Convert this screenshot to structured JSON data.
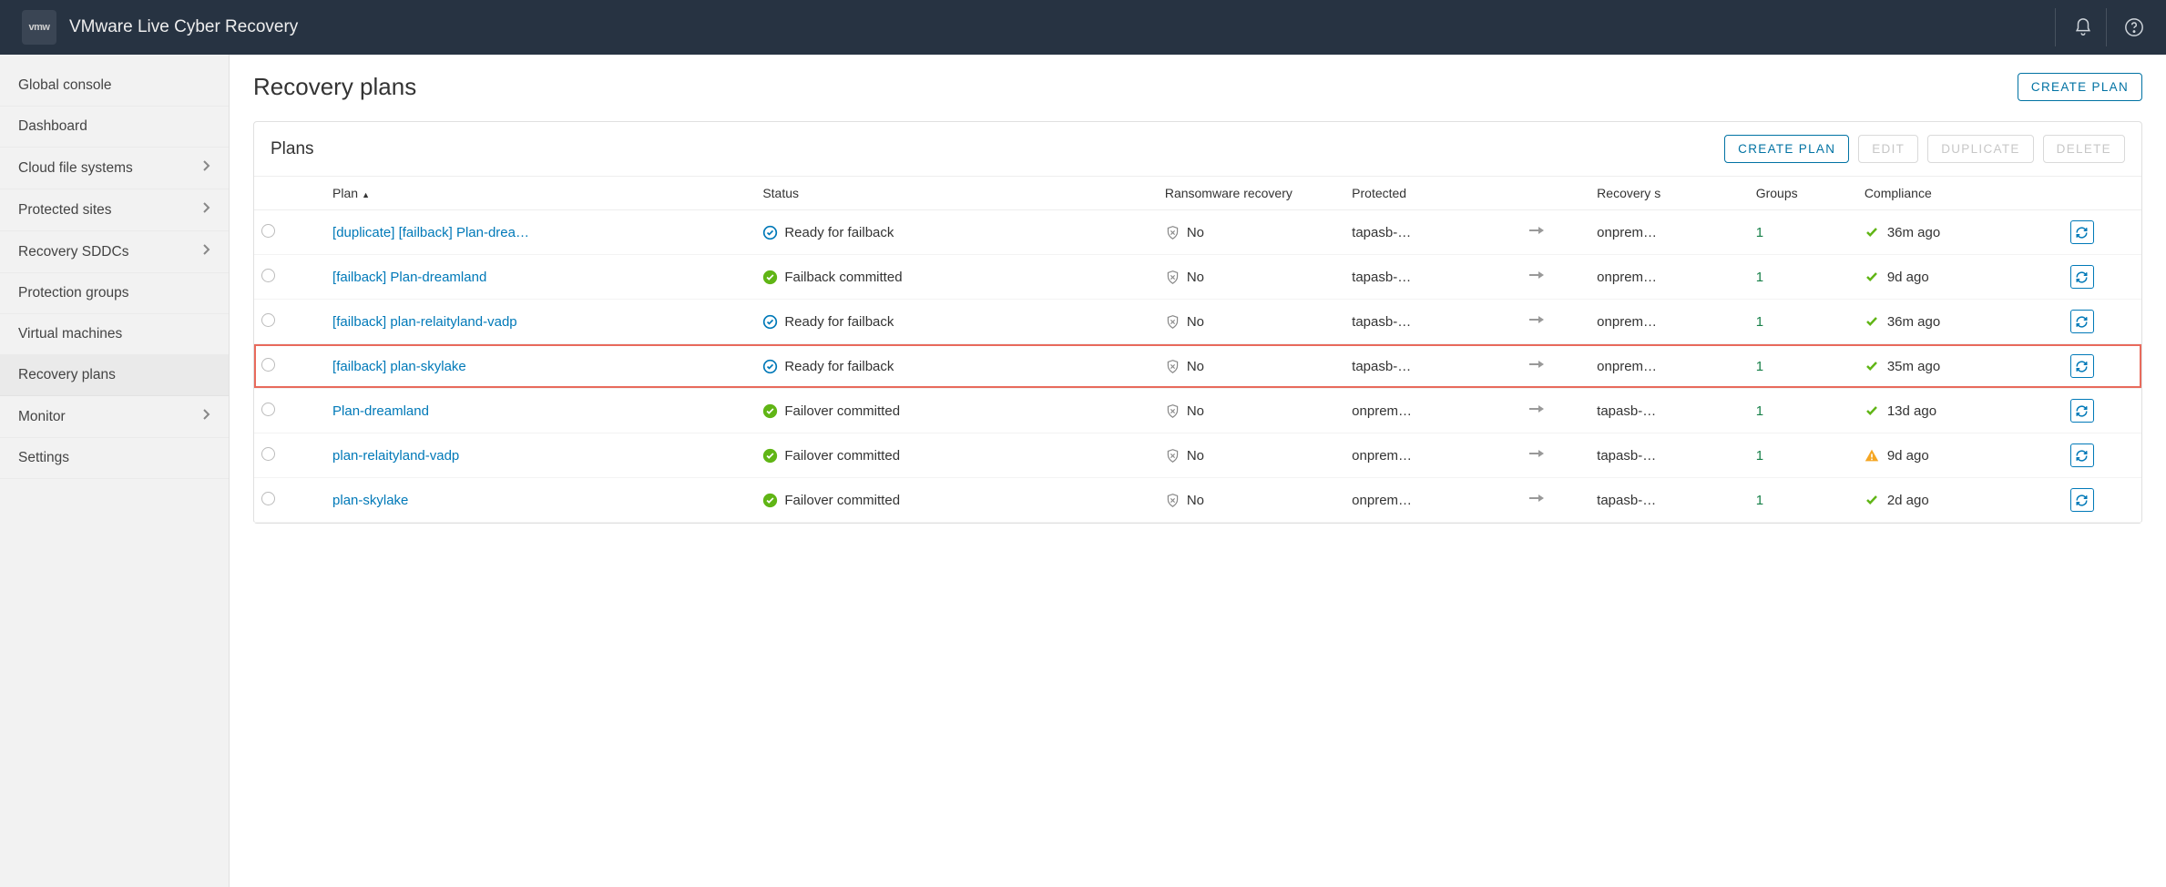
{
  "app": {
    "logo_text": "vmw",
    "title": "VMware Live Cyber Recovery"
  },
  "sidebar": {
    "items": [
      {
        "label": "Global console",
        "chevron": false,
        "active": false
      },
      {
        "label": "Dashboard",
        "chevron": false,
        "active": false
      },
      {
        "label": "Cloud file systems",
        "chevron": true,
        "active": false
      },
      {
        "label": "Protected sites",
        "chevron": true,
        "active": false
      },
      {
        "label": "Recovery SDDCs",
        "chevron": true,
        "active": false
      },
      {
        "label": "Protection groups",
        "chevron": false,
        "active": false
      },
      {
        "label": "Virtual machines",
        "chevron": false,
        "active": false
      },
      {
        "label": "Recovery plans",
        "chevron": false,
        "active": true
      },
      {
        "label": "Monitor",
        "chevron": true,
        "active": false
      },
      {
        "label": "Settings",
        "chevron": false,
        "active": false
      }
    ]
  },
  "page": {
    "title": "Recovery plans",
    "create_btn": "CREATE PLAN"
  },
  "panel": {
    "title": "Plans",
    "actions": {
      "create": "CREATE PLAN",
      "edit": "EDIT",
      "duplicate": "DUPLICATE",
      "delete": "DELETE"
    },
    "columns": {
      "plan": "Plan",
      "status": "Status",
      "ransom": "Ransomware recovery",
      "protected": "Protected",
      "recovery": "Recovery s",
      "groups": "Groups",
      "compliance": "Compliance"
    },
    "rows": [
      {
        "name": "[duplicate] [failback] Plan-drea…",
        "status_kind": "ready",
        "status_text": "Ready for failback",
        "ransom": "No",
        "protected": "tapasb-…",
        "recovery": "onprem…",
        "groups": "1",
        "comp_kind": "ok",
        "compliance": "36m ago",
        "highlight": false
      },
      {
        "name": "[failback] Plan-dreamland",
        "status_kind": "committed",
        "status_text": "Failback committed",
        "ransom": "No",
        "protected": "tapasb-…",
        "recovery": "onprem…",
        "groups": "1",
        "comp_kind": "ok",
        "compliance": "9d ago",
        "highlight": false
      },
      {
        "name": "[failback] plan-relaityland-vadp",
        "status_kind": "ready",
        "status_text": "Ready for failback",
        "ransom": "No",
        "protected": "tapasb-…",
        "recovery": "onprem…",
        "groups": "1",
        "comp_kind": "ok",
        "compliance": "36m ago",
        "highlight": false
      },
      {
        "name": "[failback] plan-skylake",
        "status_kind": "ready",
        "status_text": "Ready for failback",
        "ransom": "No",
        "protected": "tapasb-…",
        "recovery": "onprem…",
        "groups": "1",
        "comp_kind": "ok",
        "compliance": "35m ago",
        "highlight": true
      },
      {
        "name": "Plan-dreamland",
        "status_kind": "committed",
        "status_text": "Failover committed",
        "ransom": "No",
        "protected": "onprem…",
        "recovery": "tapasb-…",
        "groups": "1",
        "comp_kind": "ok",
        "compliance": "13d ago",
        "highlight": false
      },
      {
        "name": "plan-relaityland-vadp",
        "status_kind": "committed",
        "status_text": "Failover committed",
        "ransom": "No",
        "protected": "onprem…",
        "recovery": "tapasb-…",
        "groups": "1",
        "comp_kind": "warn",
        "compliance": "9d ago",
        "highlight": false
      },
      {
        "name": "plan-skylake",
        "status_kind": "committed",
        "status_text": "Failover committed",
        "ransom": "No",
        "protected": "onprem…",
        "recovery": "tapasb-…",
        "groups": "1",
        "comp_kind": "ok",
        "compliance": "2d ago",
        "highlight": false
      }
    ]
  }
}
